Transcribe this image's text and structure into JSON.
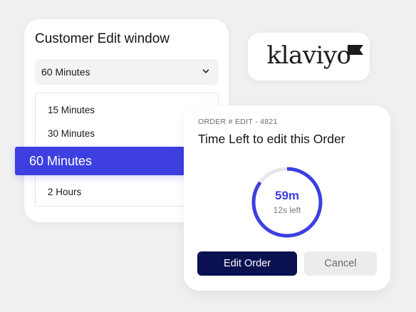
{
  "edit_window": {
    "title": "Customer Edit window",
    "select_value": "60 Minutes",
    "options": [
      "15 Minutes",
      "30 Minutes",
      "60 Minutes",
      "2 Hours"
    ],
    "selected_option": "60 Minutes"
  },
  "logo": {
    "brand": "klaviyo"
  },
  "order_card": {
    "eyebrow": "ORDER # EDIT - 4821",
    "heading": "Time Left to edit this Order",
    "time_main": "59m",
    "time_sub": "12s left",
    "progress_fraction": 0.85,
    "edit_button": "Edit Order",
    "cancel_button": "Cancel"
  },
  "colors": {
    "accent": "#3d3fe0",
    "primary_button": "#0b1050",
    "ring_track": "#e7e7ea",
    "background": "#f0f0f1"
  },
  "icons": {
    "select_chevron": "chevron-down-icon",
    "logo_flag": "flag-icon"
  }
}
